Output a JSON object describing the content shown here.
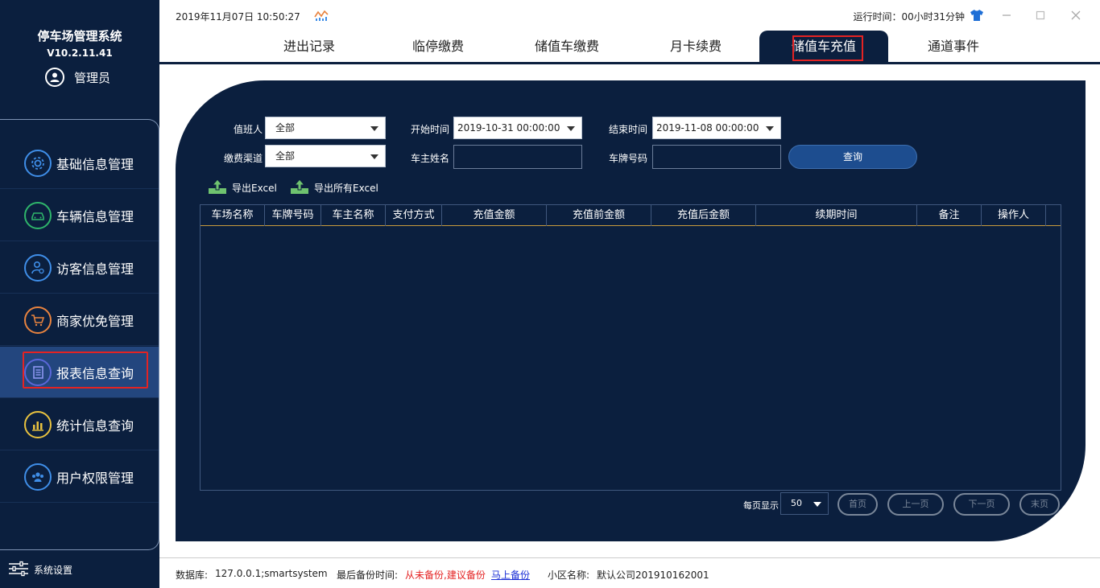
{
  "sidebar": {
    "app_title": "停车场管理系统",
    "version": "V10.2.11.41",
    "user_name": "管理员",
    "items": [
      {
        "label": "基础信息管理",
        "icon": "gear-icon",
        "color": "#3f8ee8"
      },
      {
        "label": "车辆信息管理",
        "icon": "car-icon",
        "color": "#2fb56b"
      },
      {
        "label": "访客信息管理",
        "icon": "visitor-icon",
        "color": "#3f8ee8"
      },
      {
        "label": "商家优免管理",
        "icon": "cart-icon",
        "color": "#e8833f"
      },
      {
        "label": "报表信息查询",
        "icon": "report-icon",
        "color": "#5a67d8"
      },
      {
        "label": "统计信息查询",
        "icon": "bar-chart-icon",
        "color": "#e8c23f"
      },
      {
        "label": "用户权限管理",
        "icon": "users-icon",
        "color": "#3f8ee8"
      }
    ],
    "active_index": 4,
    "settings_label": "系统设置"
  },
  "topbar": {
    "datetime": "2019年11月07日 10:50:27",
    "runtime": "运行时间：00小时31分钟"
  },
  "tabs": [
    "进出记录",
    "临停缴费",
    "储值车缴费",
    "月卡续费",
    "储值车充值",
    "通道事件"
  ],
  "active_tab": 4,
  "filters": {
    "duty_label": "值班人",
    "duty_value": "全部",
    "start_label": "开始时间",
    "start_value": "2019-10-31 00:00:00",
    "end_label": "结束时间",
    "end_value": "2019-11-08 00:00:00",
    "channel_label": "缴费渠道",
    "channel_value": "全部",
    "owner_label": "车主姓名",
    "owner_value": "",
    "plate_label": "车牌号码",
    "plate_value": "",
    "query_label": "查询"
  },
  "exports": {
    "excel": "导出Excel",
    "all_excel": "导出所有Excel"
  },
  "table": {
    "columns": [
      "车场名称",
      "车牌号码",
      "车主名称",
      "支付方式",
      "充值金额",
      "充值前金额",
      "充值后金额",
      "续期时间",
      "备注",
      "操作人"
    ],
    "rows": []
  },
  "pager": {
    "per_page_label": "每页显示",
    "per_page_value": "50",
    "first": "首页",
    "prev": "上一页",
    "next": "下一页",
    "last": "末页"
  },
  "status": {
    "db_label": "数据库:",
    "db_value": "127.0.0.1;smartsystem",
    "backup_label": "最后备份时间:",
    "backup_warn": "从未备份,建议备份",
    "backup_link": "马上备份",
    "community_label": "小区名称:",
    "community_value": "默认公司201910162001"
  },
  "colors": {
    "navy": "#0b1f3e",
    "highlight_red": "#e42323",
    "query_blue": "#1d4d8f"
  }
}
